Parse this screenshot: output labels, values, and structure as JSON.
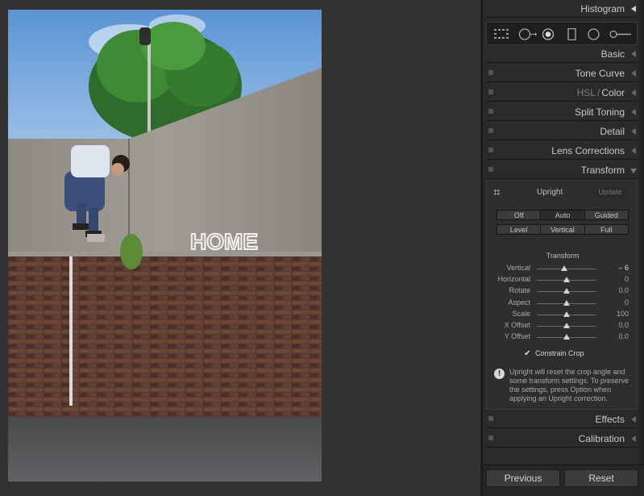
{
  "panels": {
    "histogram": "Histogram",
    "basic": "Basic",
    "tone_curve": "Tone Curve",
    "hsl": "HSL",
    "hsl_sep": "/",
    "color": "Color",
    "split_toning": "Split Toning",
    "detail": "Detail",
    "lens_corrections": "Lens Corrections",
    "transform": "Transform",
    "effects": "Effects",
    "calibration": "Calibration"
  },
  "histogram_tools": [
    "crop-overlay-icon",
    "spot-removal-icon",
    "red-eye-icon",
    "graduated-filter-icon",
    "radial-filter-icon",
    "adjustment-brush-icon"
  ],
  "transform": {
    "upright_label": "Upright",
    "update_label": "Update",
    "modes_row1": [
      "Off",
      "Auto",
      "Guided"
    ],
    "modes_row2": [
      "Level",
      "Vertical",
      "Full"
    ],
    "section_title": "Transform",
    "sliders": [
      {
        "label": "Vertical",
        "value": "– 6",
        "fraction": 0.46
      },
      {
        "label": "Horizontal",
        "value": "0",
        "fraction": 0.5
      },
      {
        "label": "Rotate",
        "value": "0.0",
        "fraction": 0.5
      },
      {
        "label": "Aspect",
        "value": "0",
        "fraction": 0.5
      },
      {
        "label": "Scale",
        "value": "100",
        "fraction": 0.5
      },
      {
        "label": "X Offset",
        "value": "0.0",
        "fraction": 0.5
      },
      {
        "label": "Y Offset",
        "value": "0.0",
        "fraction": 0.5
      }
    ],
    "constrain_crop_label": "Constrain Crop",
    "constrain_crop_checked": true,
    "info_text": "Upright will reset the crop angle and some transform settings. To preserve the settings, press Option when applying an Upright correction."
  },
  "buttons": {
    "previous": "Previous",
    "reset": "Reset"
  },
  "photo": {
    "wall_text": "HOME"
  }
}
